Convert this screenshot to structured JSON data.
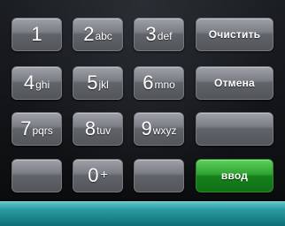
{
  "keypad": {
    "k1": {
      "digit": "1",
      "letters": ""
    },
    "k2": {
      "digit": "2",
      "letters": "abc"
    },
    "k3": {
      "digit": "3",
      "letters": "def"
    },
    "k4": {
      "digit": "4",
      "letters": "ghi"
    },
    "k5": {
      "digit": "5",
      "letters": "jkl"
    },
    "k6": {
      "digit": "6",
      "letters": "mno"
    },
    "k7": {
      "digit": "7",
      "letters": "pqrs"
    },
    "k8": {
      "digit": "8",
      "letters": "tuv"
    },
    "k9": {
      "digit": "9",
      "letters": "wxyz"
    },
    "k0": {
      "digit": "0",
      "letters": "+"
    }
  },
  "actions": {
    "clear_label": "Очистить",
    "cancel_label": "Отмена",
    "enter_label": "ввод"
  },
  "colors": {
    "enter_button": "#2fa232",
    "bottom_bar": "#2a9aa0"
  }
}
